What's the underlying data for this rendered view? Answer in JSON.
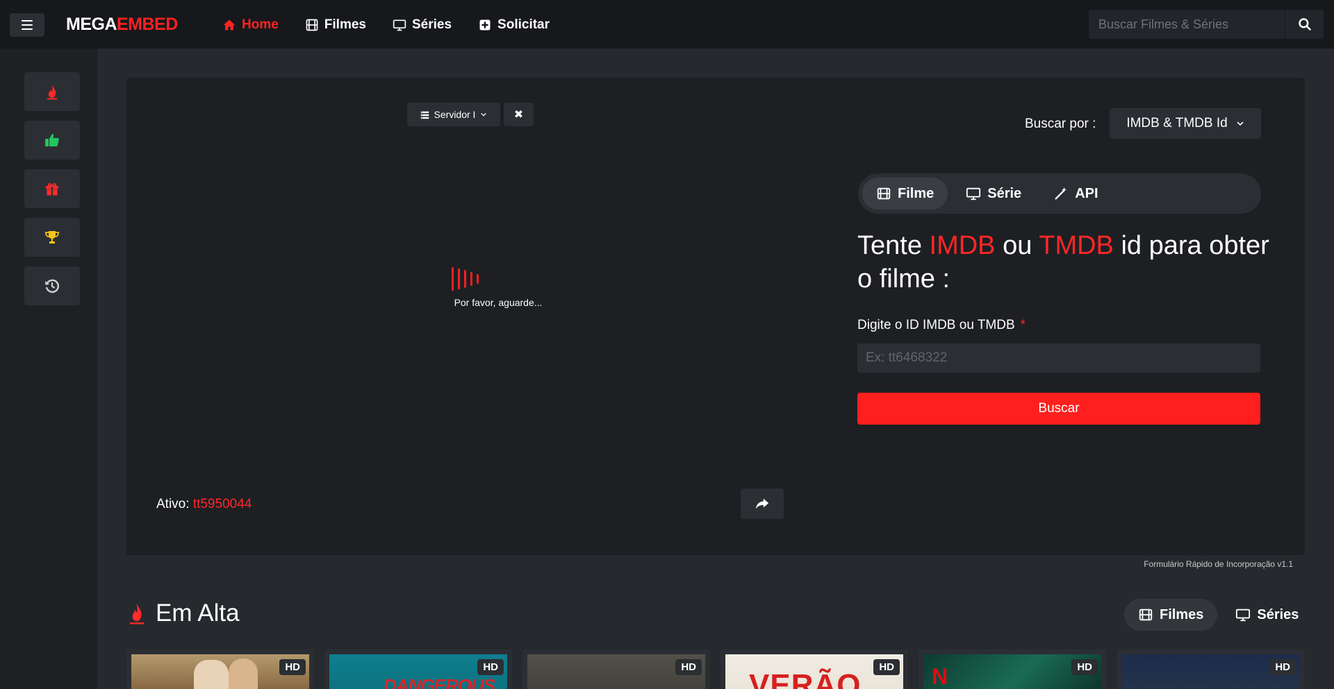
{
  "brand": {
    "part1": "MEGA",
    "part2": "EMBED"
  },
  "nav": {
    "home": "Home",
    "movies": "Filmes",
    "series": "Séries",
    "request": "Solicitar"
  },
  "search": {
    "placeholder": "Buscar Filmes & Séries"
  },
  "sidebar": {
    "items": [
      {
        "icon": "fire-icon"
      },
      {
        "icon": "thumbs-up-icon"
      },
      {
        "icon": "gift-icon"
      },
      {
        "icon": "trophy-icon"
      },
      {
        "icon": "history-icon"
      }
    ]
  },
  "player": {
    "server_label": "Servidor I",
    "close_symbol": "✖",
    "loading_text": "Por favor, aguarde...",
    "active_label": "Ativo:",
    "active_value": "tt5950044"
  },
  "form": {
    "search_by_label": "Buscar por :",
    "search_by_value": "IMDB & TMDB Id",
    "tabs": [
      {
        "label": "Filme",
        "active": true
      },
      {
        "label": "Série",
        "active": false
      },
      {
        "label": "API",
        "active": false
      }
    ],
    "headline": {
      "part1": "Tente ",
      "imdb": "IMDB",
      "part2": " ou ",
      "tmdb": "TMDB",
      "part3": " id para obter o filme :"
    },
    "field_label": "Digite o ID IMDB ou TMDB",
    "required_mark": "*",
    "field_placeholder": "Ex: tt6468322",
    "submit_label": "Buscar"
  },
  "footnote": "Formulário Rápido de Incorporação v1.1",
  "trending": {
    "title": "Em Alta",
    "tabs": [
      {
        "label": "Filmes",
        "active": true
      },
      {
        "label": "Séries",
        "active": false
      }
    ],
    "cards": [
      {
        "badge": "HD",
        "poster_text": ""
      },
      {
        "badge": "HD",
        "poster_text": "DANGEROUS"
      },
      {
        "badge": "HD",
        "poster_text": ""
      },
      {
        "badge": "HD",
        "poster_text": "VERÃO"
      },
      {
        "badge": "HD",
        "poster_text": "N"
      },
      {
        "badge": "HD",
        "poster_text": ""
      }
    ]
  },
  "colors": {
    "accent": "#ff2020",
    "background": "#26292d",
    "panel": "#1d1f23",
    "navbar": "#16181b",
    "like_green": "#22c55e",
    "trophy_yellow": "#f5c518"
  }
}
